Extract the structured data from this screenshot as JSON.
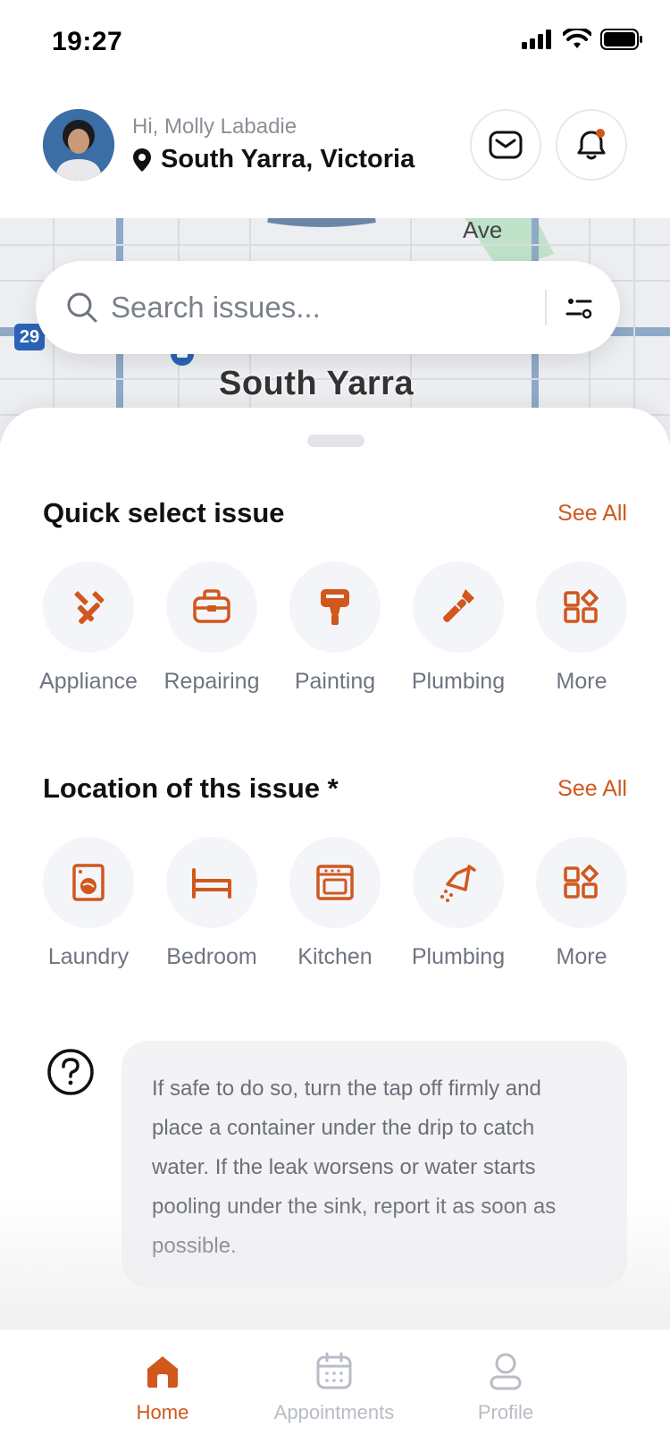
{
  "status_bar": {
    "time": "19:27"
  },
  "header": {
    "greeting": "Hi, Molly Labadie",
    "location": "South Yarra, Victoria"
  },
  "map": {
    "area_label": "South Yarra",
    "street_fragment": "Ave",
    "route_badge": "29"
  },
  "search": {
    "placeholder": "Search issues..."
  },
  "quick_select": {
    "title": "Quick select issue",
    "see_all": "See All",
    "items": [
      {
        "label": "Appliance",
        "icon": "tools-icon"
      },
      {
        "label": "Repairing",
        "icon": "toolbox-icon"
      },
      {
        "label": "Painting",
        "icon": "paint-roller-icon"
      },
      {
        "label": "Plumbing",
        "icon": "wrench-icon"
      },
      {
        "label": "More",
        "icon": "grid-shapes-icon"
      }
    ]
  },
  "location_issue": {
    "title": "Location of ths issue *",
    "see_all": "See All",
    "items": [
      {
        "label": "Laundry",
        "icon": "washing-machine-icon"
      },
      {
        "label": "Bedroom",
        "icon": "bed-icon"
      },
      {
        "label": "Kitchen",
        "icon": "oven-icon"
      },
      {
        "label": "Plumbing",
        "icon": "shower-icon"
      },
      {
        "label": "More",
        "icon": "grid-shapes-icon"
      }
    ]
  },
  "tip": {
    "text": "If safe to do so, turn the tap off firmly and place a container under the drip to catch water. If the leak worsens or water starts pooling under the sink, report it as soon as possible."
  },
  "tabs": [
    {
      "label": "Home",
      "icon": "home-icon",
      "active": true
    },
    {
      "label": "Appointments",
      "icon": "calendar-icon",
      "active": false
    },
    {
      "label": "Profile",
      "icon": "user-icon",
      "active": false
    }
  ],
  "colors": {
    "accent": "#d1571d",
    "chip_bg": "#f4f5f9",
    "muted_text": "#6e7480"
  }
}
